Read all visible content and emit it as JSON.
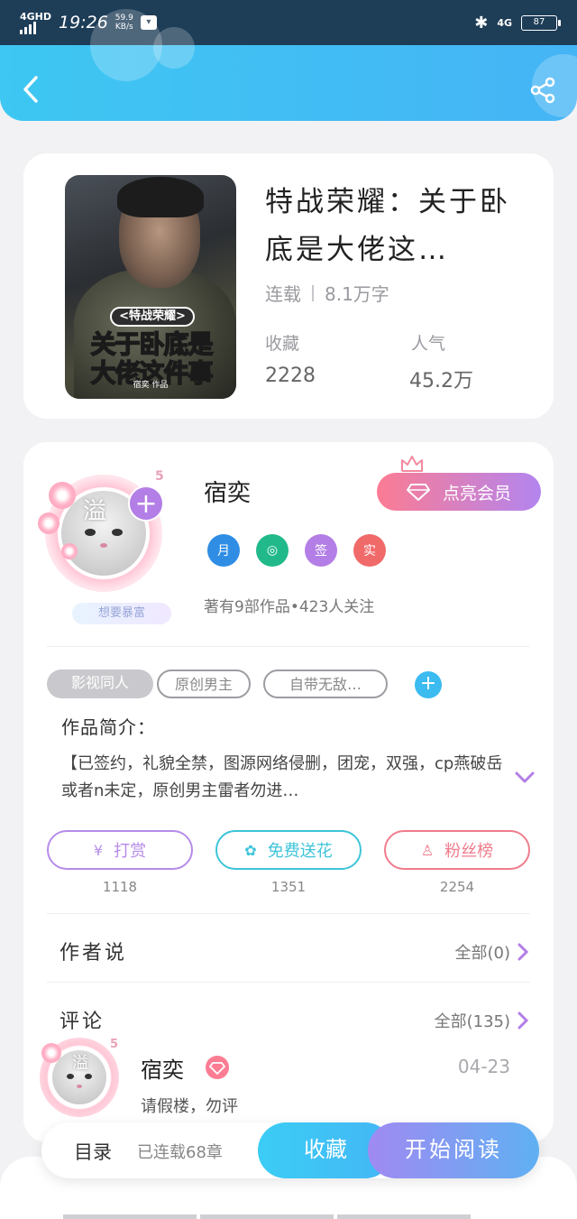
{
  "status_bar": {
    "network": "4GHD",
    "time": "19:26",
    "speed_value": "59.9",
    "speed_unit": "KB/s",
    "net_right": "4G",
    "battery": "87"
  },
  "book": {
    "title": "特战荣耀：关于卧底是大佬这…",
    "status": "连载",
    "word_count": "8.1万字",
    "collect_label": "收藏",
    "collect_value": "2228",
    "popularity_label": "人气",
    "popularity_value": "45.2万",
    "cover": {
      "subtitle": "<特战荣耀>",
      "line1": "关于卧底是",
      "line2": "大佬这件事",
      "author": "宿奕 作品"
    }
  },
  "author": {
    "name": "宿奕",
    "avatar_text": "溢",
    "avatar_level": "5",
    "avatar_tag": "想要暴富",
    "vip_button": "点亮会员",
    "badges": [
      {
        "label": "月",
        "color": "#2f8de4"
      },
      {
        "label": "◎",
        "color": "#22b98a"
      },
      {
        "label": "签",
        "color": "#b37ee6"
      },
      {
        "label": "实",
        "color": "#f06a6a"
      }
    ],
    "stats": "著有9部作品•423人关注"
  },
  "tags": [
    "影视同人",
    "原创男主",
    "自带无敌…"
  ],
  "intro": {
    "title": "作品简介：",
    "text": "【已签约，礼貌全禁，图源网络侵删，团宠，双强，cp燕破岳或者n未定，原创男主雷者勿进…"
  },
  "actions": [
    {
      "label": "打赏",
      "icon": "¥",
      "count": "1118",
      "color": "#b68be8"
    },
    {
      "label": "免费送花",
      "icon": "✿",
      "count": "1351",
      "color": "#3ec4d9"
    },
    {
      "label": "粉丝榜",
      "icon": "♙",
      "count": "2254",
      "color": "#f07c8c"
    }
  ],
  "author_says": {
    "title": "作者说",
    "more": "全部(0)"
  },
  "comments": {
    "title": "评论",
    "more": "全部(135)",
    "first": {
      "name": "宿奕",
      "avatar_text": "溢",
      "level": "5",
      "date": "04-23",
      "text": "请假楼，勿评"
    }
  },
  "bottom": {
    "toc": "目录",
    "chapters": "已连载68章",
    "collect": "收藏",
    "read": "开始阅读"
  },
  "colors": {
    "header_gradient_start": "#3ec7f2",
    "header_gradient_end": "#45b4f5",
    "accent_purple": "#b37ee6",
    "accent_pink": "#fb7c93"
  }
}
